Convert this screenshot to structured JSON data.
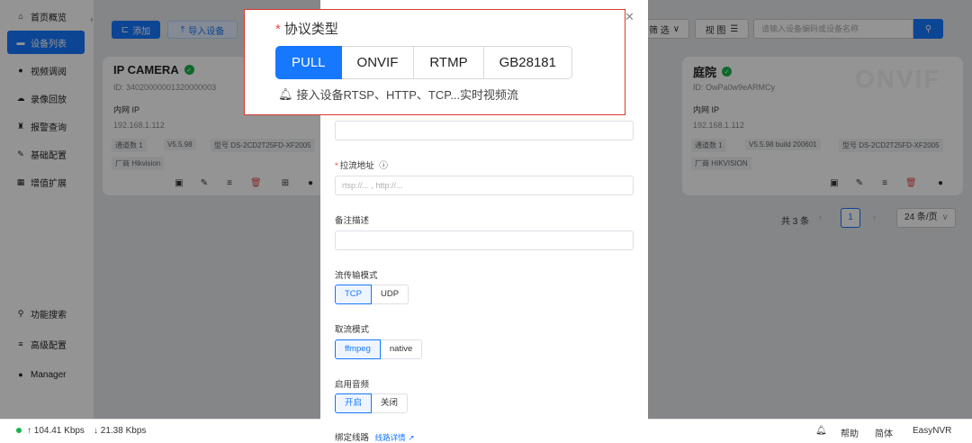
{
  "sidebar": {
    "items": [
      {
        "icon": "home-icon",
        "glyph": "⌂",
        "label": "首页概览"
      },
      {
        "icon": "device-list-icon",
        "glyph": "▬",
        "label": "设备列表"
      },
      {
        "icon": "video-preview-icon",
        "glyph": "●",
        "label": "视频调阅"
      },
      {
        "icon": "cloud-playback-icon",
        "glyph": "☁",
        "label": "录像回放"
      },
      {
        "icon": "alarm-icon",
        "glyph": "♜",
        "label": "报警查询"
      },
      {
        "icon": "edit-config-icon",
        "glyph": "✎",
        "label": "基础配置"
      },
      {
        "icon": "grid-extension-icon",
        "glyph": "▦",
        "label": "增值扩展"
      }
    ],
    "bottom_items": [
      {
        "icon": "search-icon",
        "glyph": "⚲",
        "label": "功能搜索"
      },
      {
        "icon": "menu-icon",
        "glyph": "≡",
        "label": "高级配置"
      },
      {
        "icon": "user-icon",
        "glyph": "●",
        "label": "Manager"
      }
    ]
  },
  "toolbar": {
    "add_label": "添加",
    "import_label": "导入设备",
    "filter_label": "筛 选",
    "view_label": "视 图",
    "search_placeholder": "请输入设备编码或设备名称"
  },
  "cards": [
    {
      "name": "IP CAMERA",
      "id": "ID: 34020000001320000003",
      "net_label": "内网 IP",
      "ip": "192.168.1.112",
      "channels": "通道数 1",
      "version": "V5.5.98",
      "model": "型号 DS-2CD2T25FD-XF2005",
      "vendor": "厂商 Hikvision"
    },
    {
      "name": "庭院",
      "id": "ID: OwPa0w9eARMCy",
      "net_label": "内网 IP",
      "ip": "192.168.1.112",
      "channels": "通道数 1",
      "version": "V5.5.98 build 200601",
      "model": "型号 DS-2CD2T25FD-XF2005",
      "vendor": "厂商 HIKVISION",
      "watermark": "ONVIF"
    }
  ],
  "pagination": {
    "total": "共 3 条",
    "current_page": "1",
    "page_size": "24 条/页"
  },
  "status_bar": {
    "upload": "↑ 104.41 Kbps",
    "download": "↓ 21.38 Kbps",
    "help": "帮助",
    "language": "简体",
    "product": "EasyNVR"
  },
  "drawer": {
    "stream_url_label": "拉流地址",
    "stream_url_placeholder": "rtsp://... , http://...",
    "remark_label": "备注描述",
    "transport_label": "流传输模式",
    "transport_options": [
      "TCP",
      "UDP"
    ],
    "transport_selected": "TCP",
    "pull_mode_label": "取流模式",
    "pull_mode_options": [
      "ffmpeg",
      "native"
    ],
    "pull_mode_selected": "ffmpeg",
    "audio_label": "启用音频",
    "audio_options": [
      "开启",
      "关闭"
    ],
    "audio_selected": "开启",
    "route_label": "绑定线路",
    "route_link": "线路详情"
  },
  "protocol_popup": {
    "title": "协议类型",
    "options": [
      "PULL",
      "ONVIF",
      "RTMP",
      "GB28181"
    ],
    "selected": "PULL",
    "hint": "接入设备RTSP、HTTP、TCP...实时视频流"
  },
  "colors": {
    "accent": "#1677ff",
    "online": "#19b34b",
    "danger": "#e84a4a",
    "highlight_border": "#d93a31"
  }
}
